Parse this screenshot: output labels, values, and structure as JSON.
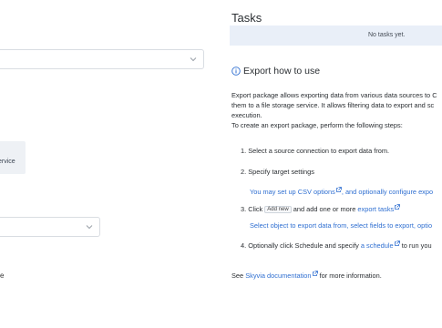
{
  "left": {
    "gray_panel_fragment": "ervice",
    "bottom_fragment": "e"
  },
  "tasks": {
    "title": "Tasks",
    "empty_text": "No tasks yet."
  },
  "export_help": {
    "title": "Export how to use",
    "intro_line1": "Export package allows exporting data from various data sources to C",
    "intro_line2": "them to a file storage service. It allows filtering data to export and sc",
    "intro_line3": "execution.",
    "intro_line4": "To create an export package, perform the following steps:",
    "step1": "1. Select a source connection to export data from.",
    "step2": "2. Specify target settings",
    "step2_sub_prefix": "You may set up",
    "step2_sub_link": "CSV options",
    "step2_sub_suffix": ", and optionally configure expo",
    "step3_prefix": "3. Click",
    "step3_button": "Add new",
    "step3_middle": "and add one or more",
    "step3_link": "export tasks",
    "step3_sub": "Select object to export data from, select fields to export, optio",
    "step4_prefix": "4. Optionally click Schedule and specify",
    "step4_link": "a schedule",
    "step4_suffix": "to run you",
    "see_prefix": "See",
    "see_link": "Skyvia documentation",
    "see_suffix": "for more information."
  },
  "colors": {
    "link": "#2f6fd1",
    "tasks_bg": "#e9eff8",
    "panel_bg": "#eef1f5"
  }
}
